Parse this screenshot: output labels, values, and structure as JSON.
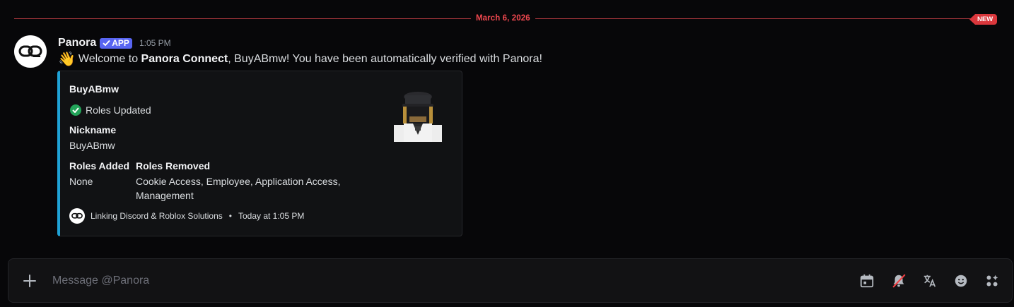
{
  "divider": {
    "date": "March 6, 2026",
    "new_badge": "NEW"
  },
  "message": {
    "author": "Panora",
    "app_tag": "APP",
    "timestamp": "1:05 PM",
    "emoji": "👋",
    "text_prefix": "Welcome to ",
    "text_bold": "Panora Connect",
    "text_suffix": ", BuyABmw! You have been automatically verified with Panora!"
  },
  "embed": {
    "accent_color": "#1fa2d6",
    "author": "BuyABmw",
    "status": "Roles Updated",
    "fields": {
      "nickname_name": "Nickname",
      "nickname_value": "BuyABmw",
      "roles_added_name": "Roles Added",
      "roles_added_value": "None",
      "roles_removed_name": "Roles Removed",
      "roles_removed_value": "Cookie Access, Employee, Application Access, Management"
    },
    "footer_text": "Linking Discord & Roblox Solutions",
    "footer_bullet": "•",
    "footer_time": "Today at 1:05 PM"
  },
  "composer": {
    "placeholder": "Message @Panora",
    "icons": [
      "plus-icon",
      "calendar-icon",
      "mute-notification-icon",
      "translate-icon",
      "emoji-icon",
      "apps-icon"
    ]
  }
}
